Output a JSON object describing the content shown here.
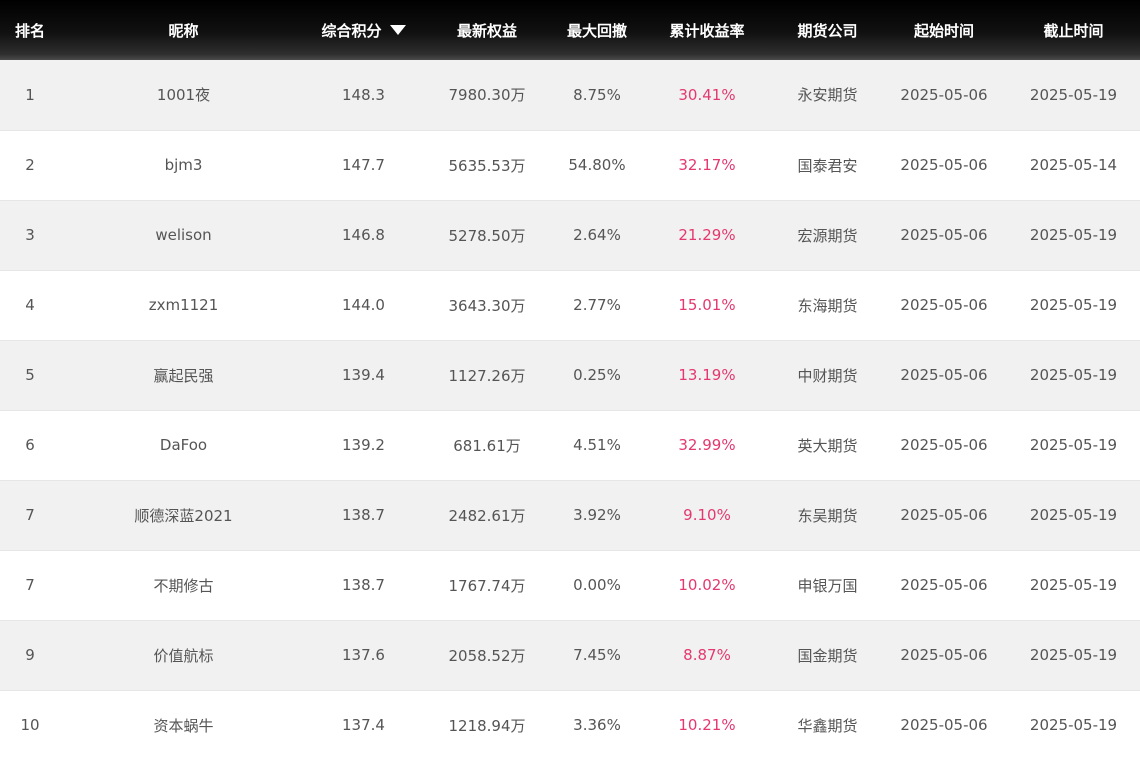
{
  "table": {
    "headers": {
      "rank": "排名",
      "nickname": "昵称",
      "score": "综合积分",
      "equity": "最新权益",
      "drawdown": "最大回撤",
      "return_rate": "累计收益率",
      "company": "期货公司",
      "start": "起始时间",
      "end": "截止时间"
    },
    "sort": {
      "column": "score",
      "direction": "desc",
      "icon": "caret-down-icon"
    },
    "rows": [
      {
        "rank": "1",
        "nickname": "1001夜",
        "score": "148.3",
        "equity": "7980.30万",
        "drawdown": "8.75%",
        "return_rate": "30.41%",
        "company": "永安期货",
        "start": "2025-05-06",
        "end": "2025-05-19"
      },
      {
        "rank": "2",
        "nickname": "bjm3",
        "score": "147.7",
        "equity": "5635.53万",
        "drawdown": "54.80%",
        "return_rate": "32.17%",
        "company": "国泰君安",
        "start": "2025-05-06",
        "end": "2025-05-14"
      },
      {
        "rank": "3",
        "nickname": "welison",
        "score": "146.8",
        "equity": "5278.50万",
        "drawdown": "2.64%",
        "return_rate": "21.29%",
        "company": "宏源期货",
        "start": "2025-05-06",
        "end": "2025-05-19"
      },
      {
        "rank": "4",
        "nickname": "zxm1121",
        "score": "144.0",
        "equity": "3643.30万",
        "drawdown": "2.77%",
        "return_rate": "15.01%",
        "company": "东海期货",
        "start": "2025-05-06",
        "end": "2025-05-19"
      },
      {
        "rank": "5",
        "nickname": "赢起民强",
        "score": "139.4",
        "equity": "1127.26万",
        "drawdown": "0.25%",
        "return_rate": "13.19%",
        "company": "中财期货",
        "start": "2025-05-06",
        "end": "2025-05-19"
      },
      {
        "rank": "6",
        "nickname": "DaFoo",
        "score": "139.2",
        "equity": "681.61万",
        "drawdown": "4.51%",
        "return_rate": "32.99%",
        "company": "英大期货",
        "start": "2025-05-06",
        "end": "2025-05-19"
      },
      {
        "rank": "7",
        "nickname": "顺德深蓝2021",
        "score": "138.7",
        "equity": "2482.61万",
        "drawdown": "3.92%",
        "return_rate": "9.10%",
        "company": "东吴期货",
        "start": "2025-05-06",
        "end": "2025-05-19"
      },
      {
        "rank": "7",
        "nickname": "不期修古",
        "score": "138.7",
        "equity": "1767.74万",
        "drawdown": "0.00%",
        "return_rate": "10.02%",
        "company": "申银万国",
        "start": "2025-05-06",
        "end": "2025-05-19"
      },
      {
        "rank": "9",
        "nickname": "价值航标",
        "score": "137.6",
        "equity": "2058.52万",
        "drawdown": "7.45%",
        "return_rate": "8.87%",
        "company": "国金期货",
        "start": "2025-05-06",
        "end": "2025-05-19"
      },
      {
        "rank": "10",
        "nickname": "资本蜗牛",
        "score": "137.4",
        "equity": "1218.94万",
        "drawdown": "3.36%",
        "return_rate": "10.21%",
        "company": "华鑫期货",
        "start": "2025-05-06",
        "end": "2025-05-19"
      }
    ]
  },
  "colors": {
    "header_bg": "#000000",
    "header_text": "#ffffff",
    "row_alt_bg": "#f1f1f1",
    "row_bg": "#ffffff",
    "text": "#555555",
    "return_rate": "#e4386f"
  }
}
